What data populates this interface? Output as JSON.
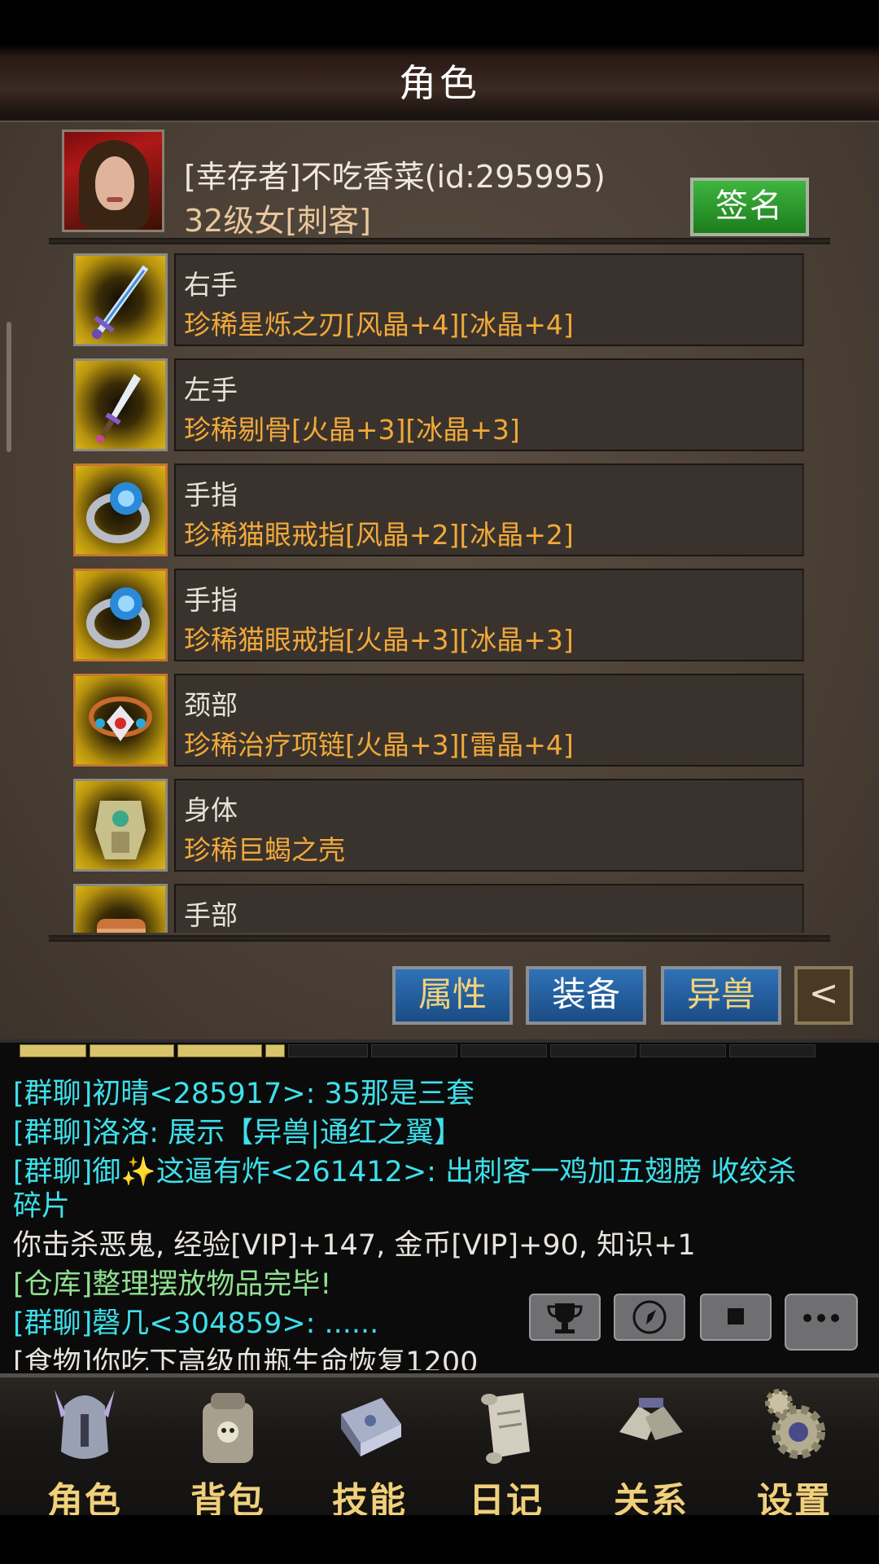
{
  "header": {
    "title": "角色"
  },
  "player": {
    "name": "[幸存者]不吃香菜(id:295995)",
    "level_line": "32级女[刺客]",
    "sign_button": "签名"
  },
  "equipment": [
    {
      "slot": "右手",
      "item": "珍稀星烁之刃[风晶+4][冰晶+4]",
      "icon": "sword-icon"
    },
    {
      "slot": "左手",
      "item": "珍稀剔骨[火晶+3][冰晶+3]",
      "icon": "dagger-icon"
    },
    {
      "slot": "手指",
      "item": "珍稀猫眼戒指[风晶+2][冰晶+2]",
      "icon": "ring-icon"
    },
    {
      "slot": "手指",
      "item": "珍稀猫眼戒指[火晶+3][冰晶+3]",
      "icon": "ring-icon"
    },
    {
      "slot": "颈部",
      "item": "珍稀治疗项链[火晶+3][雷晶+4]",
      "icon": "necklace-icon"
    },
    {
      "slot": "身体",
      "item": "珍稀巨蝎之壳",
      "icon": "armor-icon"
    },
    {
      "slot": "手部",
      "item": "",
      "icon": "gauntlet-icon"
    }
  ],
  "tabs": {
    "attributes": "属性",
    "equipment": "装备",
    "beast": "异兽",
    "back": "<"
  },
  "xp": {
    "filled_segments": 4,
    "total_segments": 10
  },
  "chat": [
    {
      "text": "[群聊]初晴<285917>: 35那是三套",
      "color": "cyan"
    },
    {
      "text": "[群聊]洛洛: 展示【异兽|通红之翼】",
      "color": "cyan"
    },
    {
      "text": "[群聊]御✨这逼有炸<261412>: 出刺客一鸡加五翅膀 收绞杀",
      "color": "cyan"
    },
    {
      "text": "碎片",
      "color": "cyan"
    },
    {
      "text": "你击杀恶鬼, 经验[VIP]+147, 金币[VIP]+90, 知识+1",
      "color": "white"
    },
    {
      "text": "[仓库]整理摆放物品完毕!",
      "color": "green"
    },
    {
      "text": "[群聊]磬几<304859>: ......",
      "color": "cyan"
    },
    {
      "text": "[食物]你吃下高级血瓶生命恢复1200",
      "color": "white"
    }
  ],
  "chat_buttons": [
    "trophy-icon",
    "compass-icon",
    "stop-icon",
    "more-icon"
  ],
  "nav": [
    {
      "label": "角色",
      "icon": "helmet-icon"
    },
    {
      "label": "背包",
      "icon": "backpack-icon"
    },
    {
      "label": "技能",
      "icon": "skillbook-icon"
    },
    {
      "label": "日记",
      "icon": "scroll-icon"
    },
    {
      "label": "关系",
      "icon": "handshake-icon"
    },
    {
      "label": "设置",
      "icon": "gear-icon"
    }
  ]
}
